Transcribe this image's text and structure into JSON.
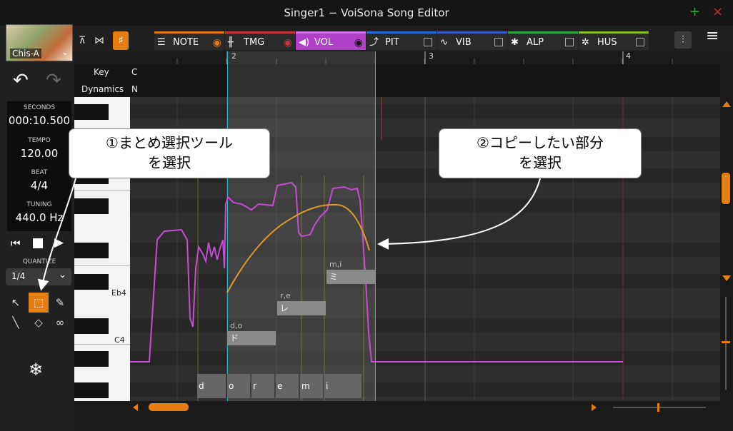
{
  "window": {
    "title": "Singer1 − VoiSona Song Editor",
    "plus": "+",
    "close": "×"
  },
  "singer": {
    "name": "Chis-A"
  },
  "info": {
    "seconds_label": "SECONDS",
    "seconds": "000:10.500",
    "tempo_label": "TEMPO",
    "tempo": "120.00",
    "beat_label": "BEAT",
    "beat": "4/4",
    "tuning_label": "TUNING",
    "tuning": "440.0 Hz"
  },
  "quantize": {
    "label": "QUANTIZE",
    "value": "1/4"
  },
  "tabs": [
    {
      "label": "NOTE",
      "color": "#e07a16"
    },
    {
      "label": "TMG",
      "color": "#c23a3a"
    },
    {
      "label": "VOL",
      "color": "#b040c8"
    },
    {
      "label": "PIT",
      "color": "#2e6fd6"
    },
    {
      "label": "VIB",
      "color": "#3a5fc8"
    },
    {
      "label": "ALP",
      "color": "#2fa84a"
    },
    {
      "label": "HUS",
      "color": "#8cbf2a"
    }
  ],
  "ruler": {
    "bars": [
      "2",
      "3",
      "4"
    ]
  },
  "rows": {
    "key_label": "Key",
    "key_value": "C",
    "dyn_label": "Dynamics",
    "dyn_value": "N"
  },
  "piano": {
    "labels": [
      "Eb4",
      "C4"
    ]
  },
  "notes": [
    {
      "phoneme": "d,o",
      "lyric": "ド"
    },
    {
      "phoneme": "r,e",
      "lyric": "レ"
    },
    {
      "phoneme": "m,i",
      "lyric": "ミ"
    }
  ],
  "lyrics_lane": [
    "d",
    "o",
    "r",
    "e",
    "m",
    "i"
  ],
  "callouts": {
    "c1_line1": "①まとめ選択ツール",
    "c1_line2": "を選択",
    "c2_line1": "②コピーしたい部分",
    "c2_line2": "を選択"
  },
  "colors": {
    "accent": "#e57e12",
    "selection": "#27b8c4",
    "volume_curve": "#c24fd0",
    "pitch_curve": "#d99a2a"
  }
}
